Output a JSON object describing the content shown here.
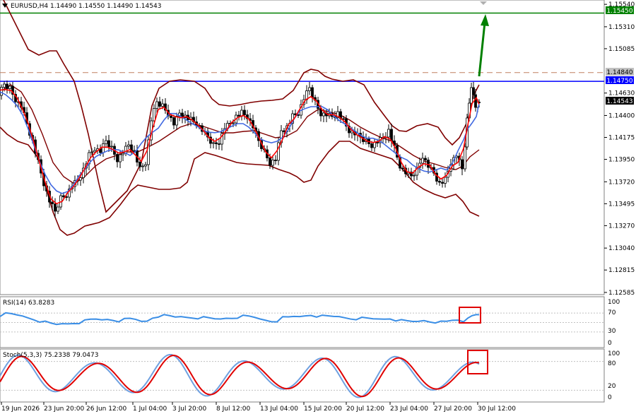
{
  "main_panel": {
    "header": "EURUSD,H4  1.14490 1.14550 1.14490 1.14543",
    "price_levels": [
      "1.15540",
      "1.15310",
      "1.15085",
      "1.14630",
      "1.14400",
      "1.14175",
      "1.13950",
      "1.13720",
      "1.13495",
      "1.13270",
      "1.13040",
      "1.12815",
      "1.12585"
    ],
    "marked_levels": [
      {
        "label": "1.15450",
        "value": 1.1545,
        "line": "solid",
        "color": "#008000"
      },
      {
        "label": "1.14840",
        "value": 1.1484,
        "line": "dashed",
        "color": "#c08060"
      },
      {
        "label": "1.14750",
        "value": 1.1475,
        "line": "solid",
        "color": "#0000ff"
      }
    ],
    "current_price_label": "1.14543",
    "current_price": 1.14543,
    "y_range": [
      1.1257,
      1.1557
    ]
  },
  "rsi_panel": {
    "header": "RSI(14) 63.8283",
    "levels": [
      "100",
      "70",
      "30",
      "0"
    ]
  },
  "stoch_panel": {
    "header": "Stoch(5,3,3) 75.2338 79.0473",
    "levels": [
      "100",
      "80",
      "20",
      "0"
    ]
  },
  "time_axis": {
    "labels": [
      "19 Jun 2026",
      "23 Jun 20:00",
      "26 Jun 12:00",
      "1 Jul 04:00",
      "3 Jul 20:00",
      "8 Jul 12:00",
      "13 Jul 04:00",
      "15 Jul 20:00",
      "20 Jul 12:00",
      "23 Jul 04:00",
      "27 Jul 20:00",
      "30 Jul 12:00"
    ]
  },
  "colors": {
    "up_arrow": "#008000",
    "bollinger": "#800000",
    "fast_ma": "#ff0000",
    "slow_ma": "#4169e1",
    "rsi_line": "#3a8ee6",
    "stoch_main": "#6fa0e0",
    "stoch_signal": "#e00000",
    "highlight_box": "#e00000",
    "candles": "#000000"
  },
  "icons": [
    "target-arrow-icon",
    "dropdown-triangle-icon"
  ]
}
